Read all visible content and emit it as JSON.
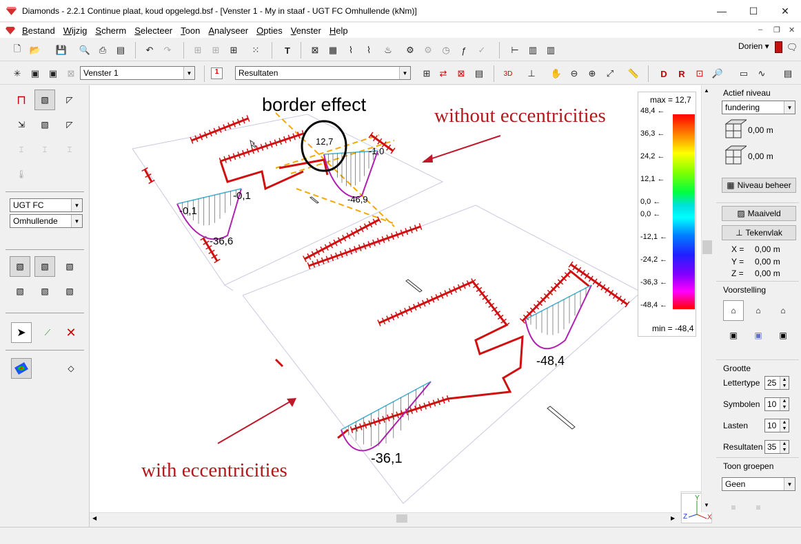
{
  "window": {
    "app_name": "Diamonds",
    "title": "Diamonds  -  2.2.1 Continue plaat, koud opgelegd.bsf - [Venster 1 - My in staaf - UGT FC Omhullende  (kNm)]",
    "minimize": "—",
    "maximize": "☐",
    "close": "✕"
  },
  "menu": [
    "Bestand",
    "Wijzig",
    "Scherm",
    "Selecteer",
    "Toon",
    "Analyseer",
    "Opties",
    "Venster",
    "Help"
  ],
  "user": {
    "name": "Dorien ▾"
  },
  "toolbar2": {
    "window_select": "Venster 1",
    "results_select": "Resultaten",
    "page_number": "1"
  },
  "left": {
    "loadcase": "UGT FC",
    "envelope": "Omhullende"
  },
  "annotations": {
    "border_effect": "border effect",
    "without_ecc": "without eccentricities",
    "with_ecc": "with eccentricities"
  },
  "diagram_values": {
    "v1": "12,7",
    "v2": "-1,0",
    "v3": "-46,9",
    "v4": "-0,1",
    "v5": "-0,1",
    "v6": "-36,6",
    "v7": "-48,4",
    "v8": "-36,1"
  },
  "legend": {
    "max": "max = 12,7",
    "min": "min = -48,4",
    "ticks": [
      "48,4",
      "36,3",
      "24,2",
      "12,1",
      "0,0",
      "0,0",
      "-12,1",
      "-24,2",
      "-36,3",
      "-48,4"
    ]
  },
  "right": {
    "level_title": "Actief niveau",
    "level_select": "fundering",
    "elev1": "0,00 m",
    "elev2": "0,00 m",
    "level_button": "Niveau beheer",
    "maaiveld": "Maaiveld",
    "tekenvlak": "Tekenvlak",
    "x_label": "X =",
    "x_val": "0,00 m",
    "y_label": "Y =",
    "y_val": "0,00 m",
    "z_label": "Z =",
    "z_val": "0,00 m",
    "voorstelling": "Voorstelling",
    "grootte": "Grootte",
    "lettertype_label": "Lettertype",
    "lettertype_val": "25",
    "symbolen_label": "Symbolen",
    "symbolen_val": "10",
    "lasten_label": "Lasten",
    "lasten_val": "10",
    "resultaten_label": "Resultaten",
    "resultaten_val": "35",
    "toon_groepen": "Toon groepen",
    "groep_select": "Geen"
  },
  "axes": {
    "x": "X",
    "y": "Y",
    "z": "Z"
  },
  "colors": {
    "accent_red": "#c81010",
    "support_red": "#d01010",
    "annotation_red": "#b01a1a",
    "orange_dash": "#f5a800"
  }
}
